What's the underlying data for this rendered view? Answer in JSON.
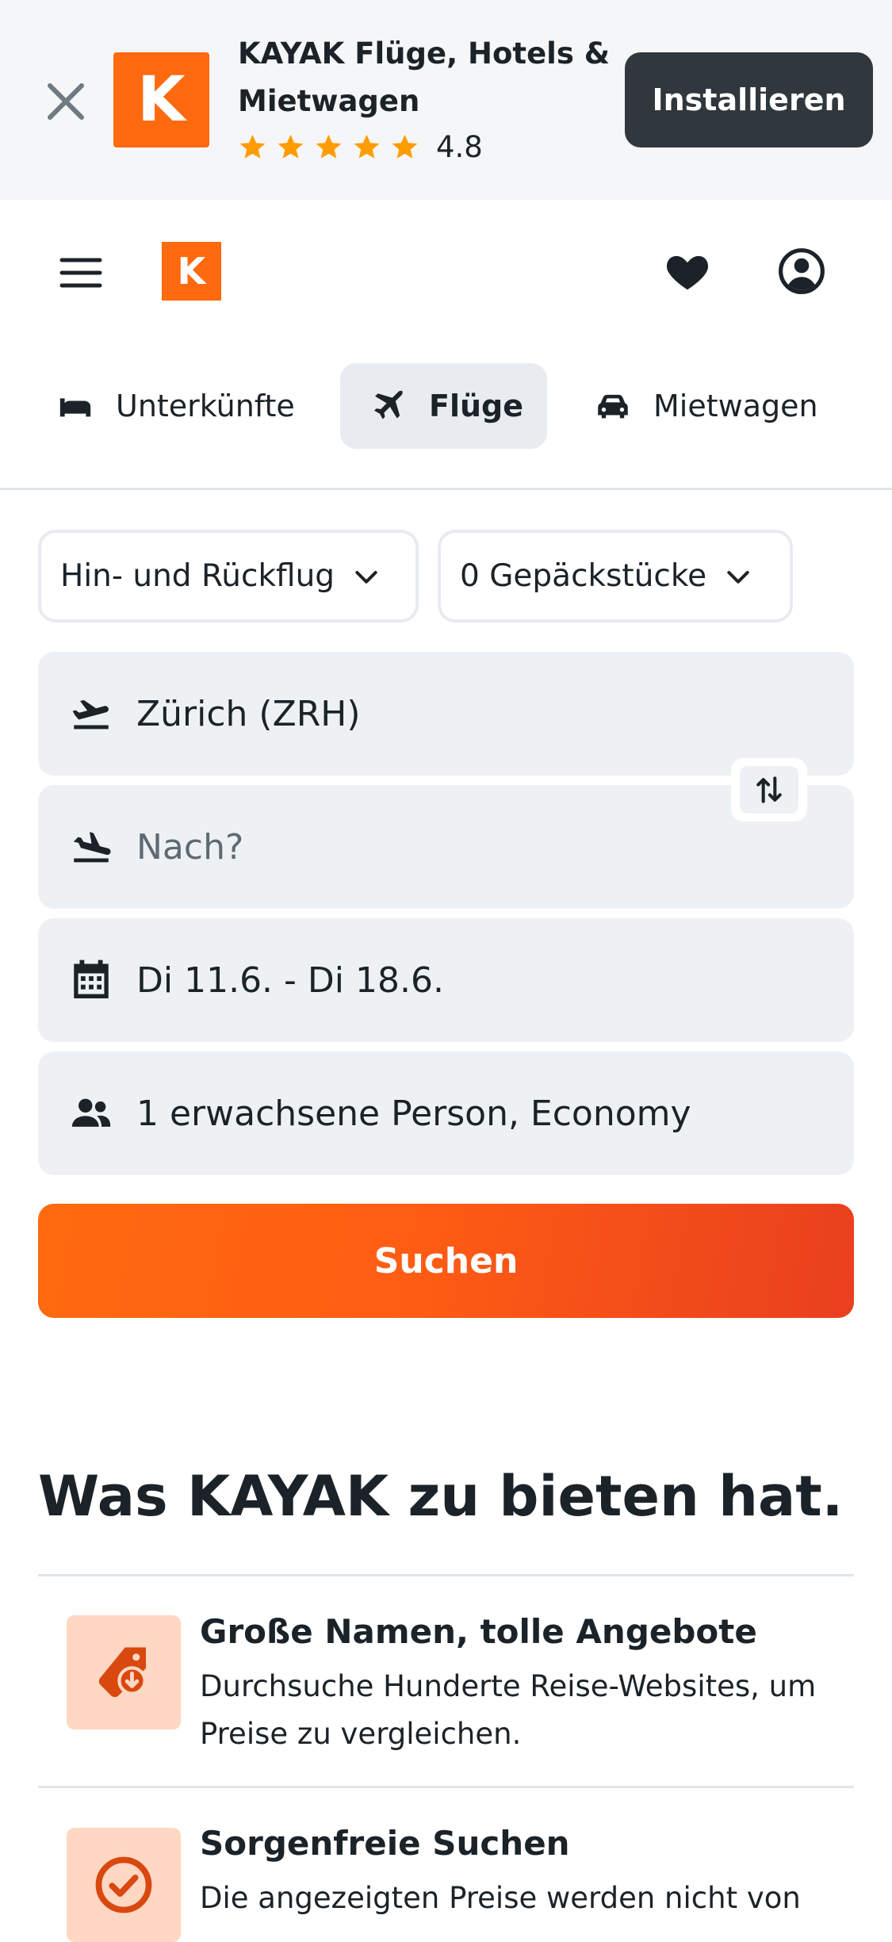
{
  "banner": {
    "title": "KAYAK Flüge, Hotels & Mietwagen",
    "logo_letter": "K",
    "rating": "4.8",
    "stars": 5,
    "install_label": "Installieren"
  },
  "header": {
    "logo_letter": "K"
  },
  "tabs": [
    {
      "label": "Unterkünfte",
      "icon": "bed-icon",
      "active": false
    },
    {
      "label": "Flüge",
      "icon": "airplane-icon",
      "active": true
    },
    {
      "label": "Mietwagen",
      "icon": "car-icon",
      "active": false
    }
  ],
  "search": {
    "trip_type": "Hin- und Rückflug",
    "bags": "0 Gepäckstücke",
    "origin": "Zürich (ZRH)",
    "destination_placeholder": "Nach?",
    "dates": "Di 11.6. - Di 18.6.",
    "travelers": "1 erwachsene Person, Economy",
    "submit_label": "Suchen"
  },
  "benefits": {
    "title": "Was KAYAK zu bieten hat.",
    "items": [
      {
        "title": "Große Namen, tolle Angebote",
        "text": "Durchsuche Hunderte Reise-Websites, um Preise zu vergleichen.",
        "icon": "price-tag-icon"
      },
      {
        "title": "Sorgenfreie Suchen",
        "text": "Die angezeigten Preise werden nicht von",
        "icon": "checkmark-circle-icon"
      }
    ]
  },
  "colors": {
    "brand": "#ff690f",
    "install_button": "#30373d",
    "field_background": "#eef1f4",
    "star": "#ff9c00",
    "benefit_icon_bg": "#ffd7c2"
  }
}
